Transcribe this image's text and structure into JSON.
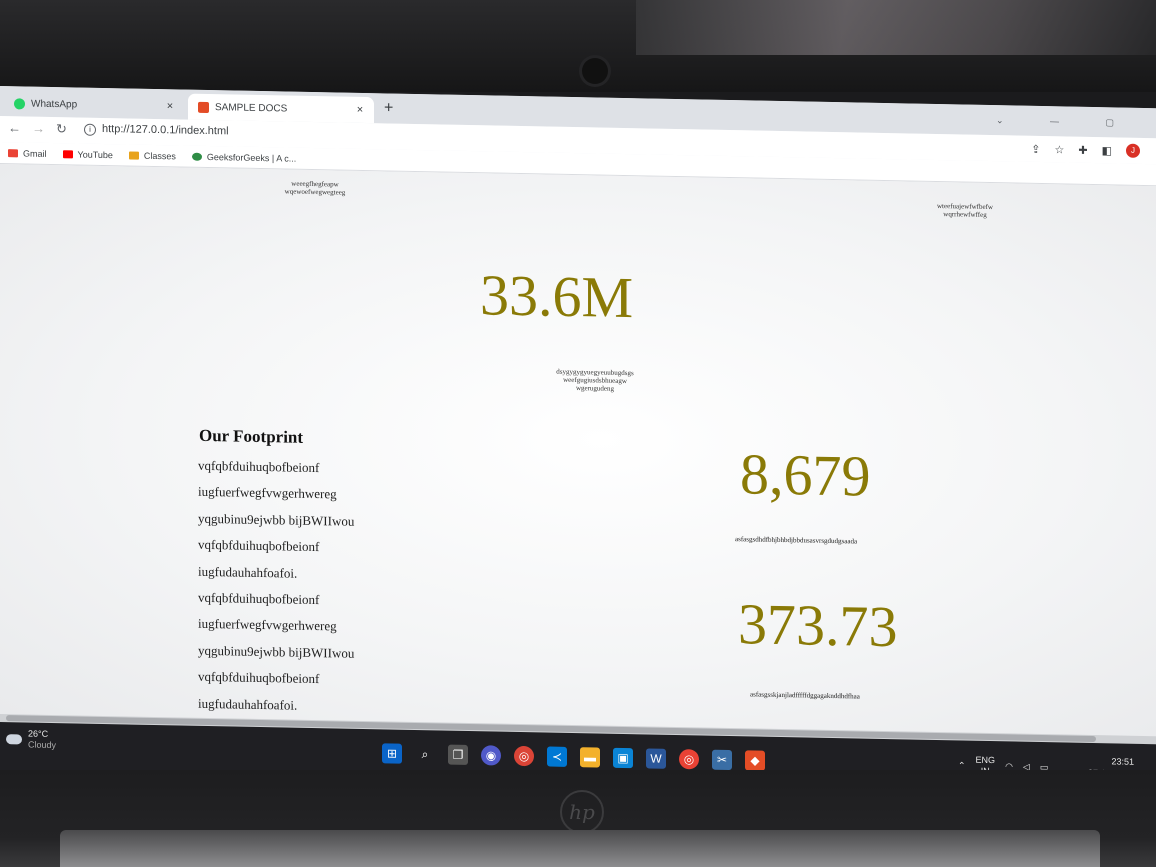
{
  "browser": {
    "tabs": [
      {
        "label": "WhatsApp",
        "close": "×"
      },
      {
        "label": "SAMPLE DOCS",
        "close": "×"
      }
    ],
    "new_tab": "+",
    "url": "http://127.0.0.1/index.html",
    "bookmarks": [
      "Gmail",
      "YouTube",
      "Classes",
      "GeeksforGeeks | A c..."
    ],
    "profile_initial": "J"
  },
  "page": {
    "top_left_text": [
      "weeegfhegfeapw",
      "wqewoefwegwegteeg"
    ],
    "top_right_text": [
      "wteefuajewfwfbefw",
      "wqrrhewfwffeg"
    ],
    "stat_main": {
      "value": "33.6M",
      "desc": [
        "dsygygygyuegyeuubugdsgs",
        "weefgugiusdsbhueagw",
        "wgerugudeng"
      ]
    },
    "footprint": {
      "title": "Our Footprint",
      "items": [
        "vqfqbfduihuqbofbeionf",
        "iugfuerfwegfvwgerhwereg",
        "yqgubinu9ejwbb bijBWIIwou",
        "vqfqbfduihuqbofbeionf",
        "iugfudauhahfoafoi.",
        "vqfqbfduihuqbofbeionf",
        "iugfuerfwegfvwgerhwereg",
        "yqgubinu9ejwbb bijBWIIwou",
        "vqfqbfduihuqbofbeionf",
        "iugfudauhahfoafoi."
      ]
    },
    "stat_2": {
      "value": "8,679",
      "desc": "asfasgsdhdfbhjbhbdjbbdusasvrsgdudgsaada"
    },
    "stat_3": {
      "value": "373.73",
      "desc": "asfasgsskjanjladfffffdggagaknddhdfhaa"
    }
  },
  "taskbar": {
    "weather_temp": "26°C",
    "weather_cond": "Cloudy",
    "lang": "ENG",
    "region": "IN",
    "time": "23:51",
    "date": "27-06-2022"
  },
  "colors": {
    "stat": "#8a7a07",
    "page_bg": "#f4f5f6",
    "taskbar": "#1f1f23"
  }
}
